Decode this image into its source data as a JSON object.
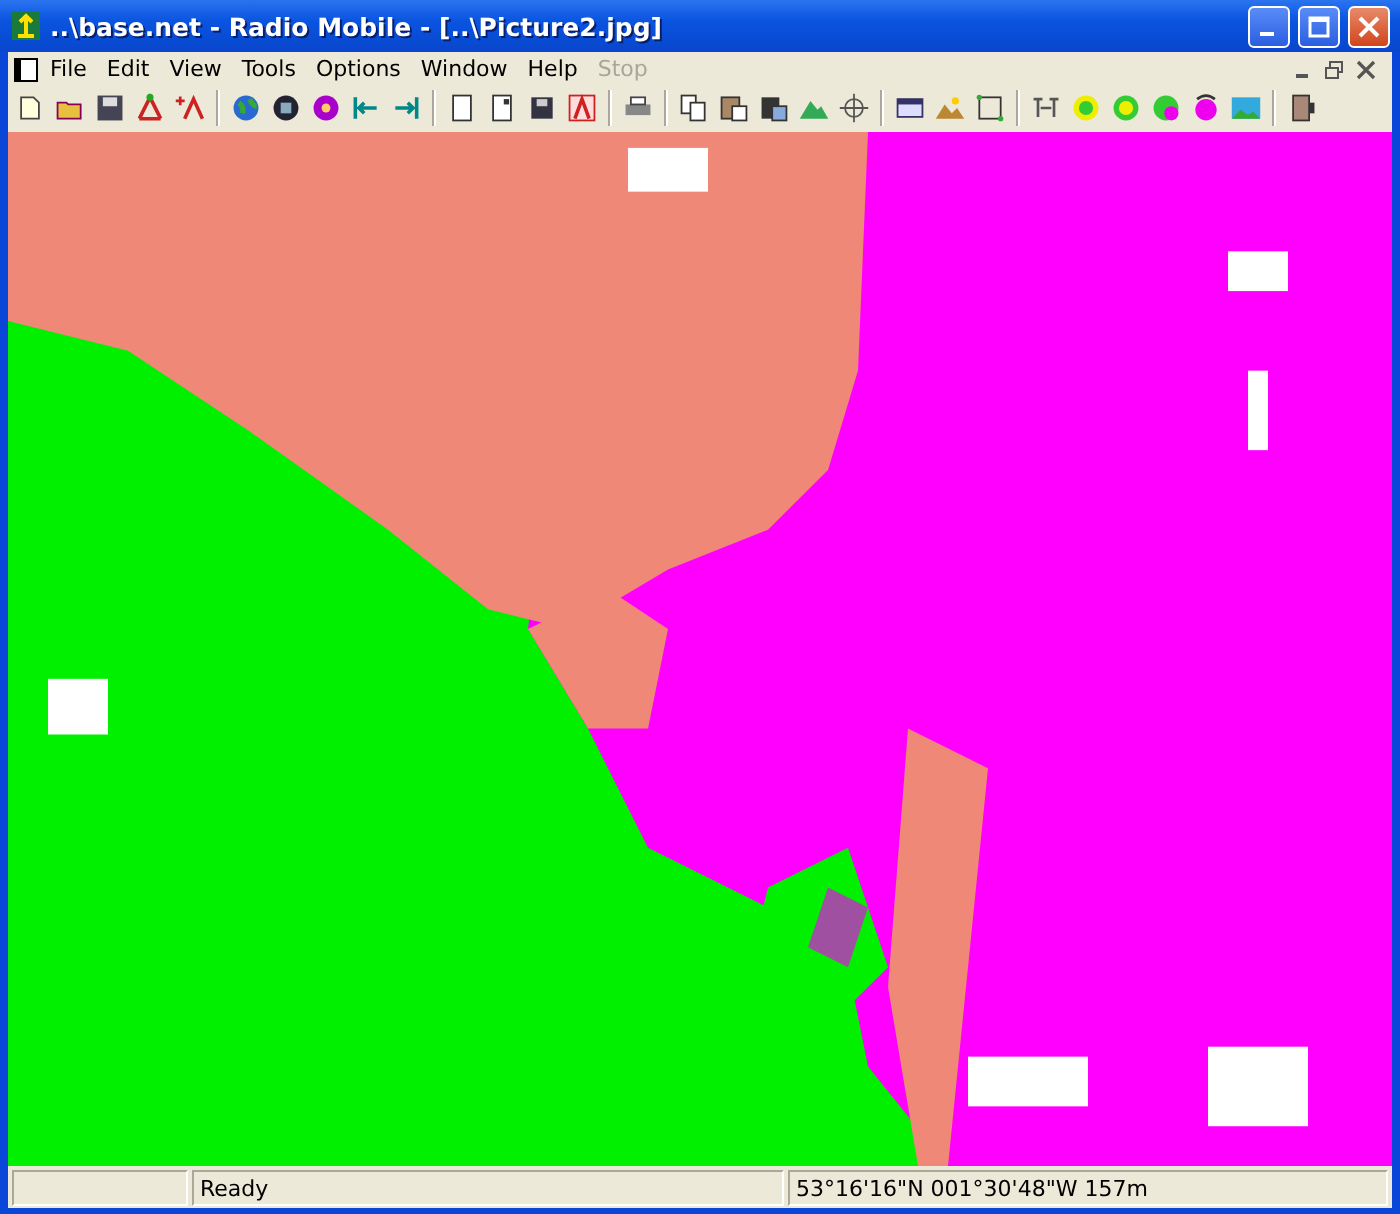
{
  "window": {
    "title": "..\\base.net - Radio Mobile - [..\\Picture2.jpg]"
  },
  "menu": [
    {
      "label": "File",
      "disabled": false
    },
    {
      "label": "Edit",
      "disabled": false
    },
    {
      "label": "View",
      "disabled": false
    },
    {
      "label": "Tools",
      "disabled": false
    },
    {
      "label": "Options",
      "disabled": false
    },
    {
      "label": "Window",
      "disabled": false
    },
    {
      "label": "Help",
      "disabled": false
    },
    {
      "label": "Stop",
      "disabled": true
    }
  ],
  "status_bar": {
    "message": "Ready",
    "coordinates": "53°16'16\"N 001°30'48\"W 157m"
  }
}
